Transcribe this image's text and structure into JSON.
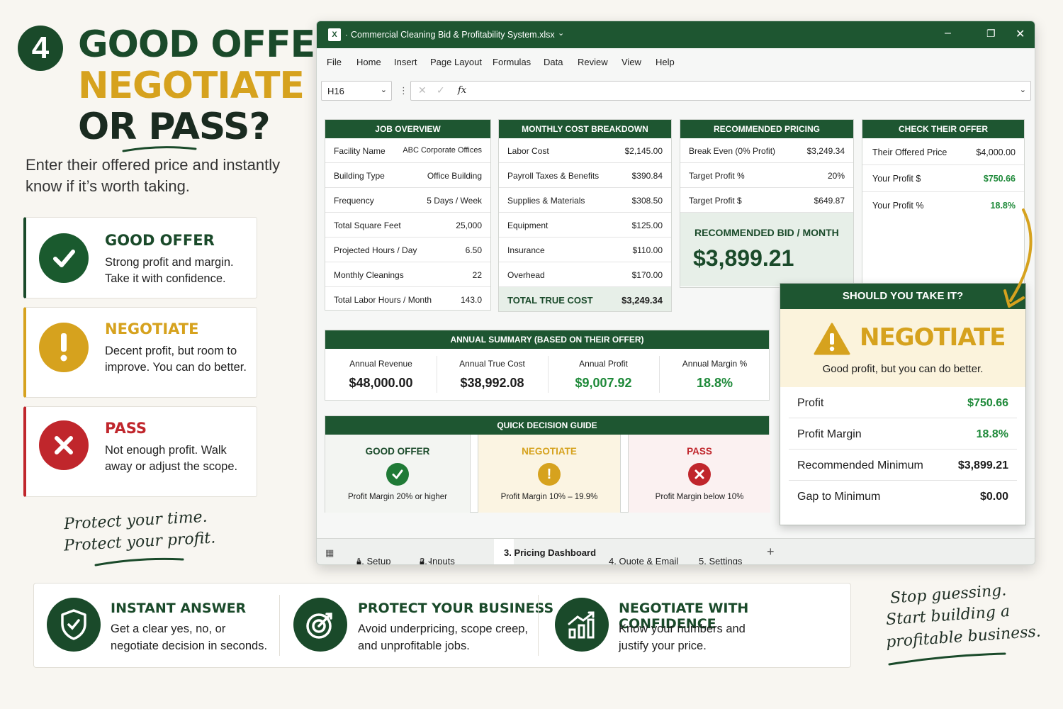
{
  "left": {
    "step_number": "4",
    "headline1": "GOOD OFFER",
    "headline2": "NEGOTIATE",
    "headline3": "OR PASS?",
    "lead": "Enter their offered price and instantly know if it’s worth taking.",
    "cards": [
      {
        "title": "GOOD OFFER",
        "desc": "Strong profit and margin. Take it with confidence."
      },
      {
        "title": "NEGOTIATE",
        "desc": "Decent profit, but room to improve. You can do better."
      },
      {
        "title": "PASS",
        "desc": "Not enough profit. Walk away or adjust the scope."
      }
    ],
    "handwritten1": "Protect your time.",
    "handwritten2": "Protect your profit."
  },
  "window": {
    "title": "Commercial Cleaning Bid & Profitability System.xlsx",
    "menu": [
      "File",
      "Home",
      "Insert",
      "Page Layout",
      "Formulas",
      "Data",
      "Review",
      "View",
      "Help"
    ],
    "name_box": "H16",
    "fx": "fx"
  },
  "job_overview": {
    "header": "JOB OVERVIEW",
    "rows": [
      {
        "k": "Facility Name",
        "v": "ABC Corporate Offices"
      },
      {
        "k": "Building Type",
        "v": "Office Building"
      },
      {
        "k": "Frequency",
        "v": "5 Days / Week"
      },
      {
        "k": "Total Square Feet",
        "v": "25,000"
      },
      {
        "k": "Projected Hours / Day",
        "v": "6.50"
      },
      {
        "k": "Monthly Cleanings",
        "v": "22"
      },
      {
        "k": "Total Labor Hours / Month",
        "v": "143.0"
      }
    ]
  },
  "cost_breakdown": {
    "header": "MONTHLY COST BREAKDOWN",
    "rows": [
      {
        "k": "Labor Cost",
        "v": "$2,145.00"
      },
      {
        "k": "Payroll Taxes & Benefits",
        "v": "$390.84"
      },
      {
        "k": "Supplies & Materials",
        "v": "$308.50"
      },
      {
        "k": "Equipment",
        "v": "$125.00"
      },
      {
        "k": "Insurance",
        "v": "$110.00"
      },
      {
        "k": "Overhead",
        "v": "$170.00"
      }
    ],
    "total_label": "TOTAL TRUE COST",
    "total_value": "$3,249.34"
  },
  "pricing": {
    "header": "RECOMMENDED PRICING",
    "rows": [
      {
        "k": "Break Even (0% Profit)",
        "v": "$3,249.34"
      },
      {
        "k": "Target Profit %",
        "v": "20%"
      },
      {
        "k": "Target Profit $",
        "v": "$649.87"
      }
    ],
    "bid_label": "RECOMMENDED BID / MONTH",
    "bid_value": "$3,899.21"
  },
  "check_offer": {
    "header": "CHECK THEIR OFFER",
    "rows": [
      {
        "k": "Their Offered Price",
        "v": "$4,000.00"
      },
      {
        "k": "Your Profit $",
        "v": "$750.66"
      },
      {
        "k": "Your Profit %",
        "v": "18.8%"
      }
    ]
  },
  "annual": {
    "header": "ANNUAL SUMMARY (BASED ON THEIR OFFER)",
    "cols": [
      {
        "k": "Annual Revenue",
        "v": "$48,000.00"
      },
      {
        "k": "Annual True Cost",
        "v": "$38,992.08"
      },
      {
        "k": "Annual Profit",
        "v": "$9,007.92"
      },
      {
        "k": "Annual Margin %",
        "v": "18.8%"
      }
    ]
  },
  "guide": {
    "header": "QUICK DECISION GUIDE",
    "cols": [
      {
        "title": "GOOD OFFER",
        "desc": "Profit Margin 20% or higher"
      },
      {
        "title": "NEGOTIATE",
        "desc": "Profit Margin 10% – 19.9%"
      },
      {
        "title": "PASS",
        "desc": "Profit Margin below 10%"
      }
    ]
  },
  "decision": {
    "header": "SHOULD YOU TAKE IT?",
    "verdict": "NEGOTIATE",
    "sub": "Good profit, but you can do better.",
    "rows": [
      {
        "k": "Profit",
        "v": "$750.66"
      },
      {
        "k": "Profit Margin",
        "v": "18.8%"
      },
      {
        "k": "Recommended Minimum",
        "v": "$3,899.21"
      },
      {
        "k": "Gap to Minimum",
        "v": "$0.00"
      }
    ]
  },
  "sheet_tabs": [
    "1. Setup",
    "2. Inputs",
    "3. Pricing Dashboard",
    "4. Quote & Email",
    "5. Settings"
  ],
  "benefits": [
    {
      "title": "INSTANT ANSWER",
      "desc1": "Get a clear yes, no, or",
      "desc2": "negotiate decision in seconds."
    },
    {
      "title": "PROTECT YOUR BUSINESS",
      "desc1": "Avoid underpricing, scope creep,",
      "desc2": "and unprofitable jobs."
    },
    {
      "title": "NEGOTIATE WITH CONFIDENCE",
      "desc1": "Know your numbers and",
      "desc2": "justify your price."
    }
  ],
  "closing1": "Stop guessing.",
  "closing2": "Start building a",
  "closing3": "profitable business.",
  "colors": {
    "brand": "#1e5631",
    "gold": "#d6a21e",
    "red": "#c0262c",
    "profit_green": "#1f8a3a"
  }
}
